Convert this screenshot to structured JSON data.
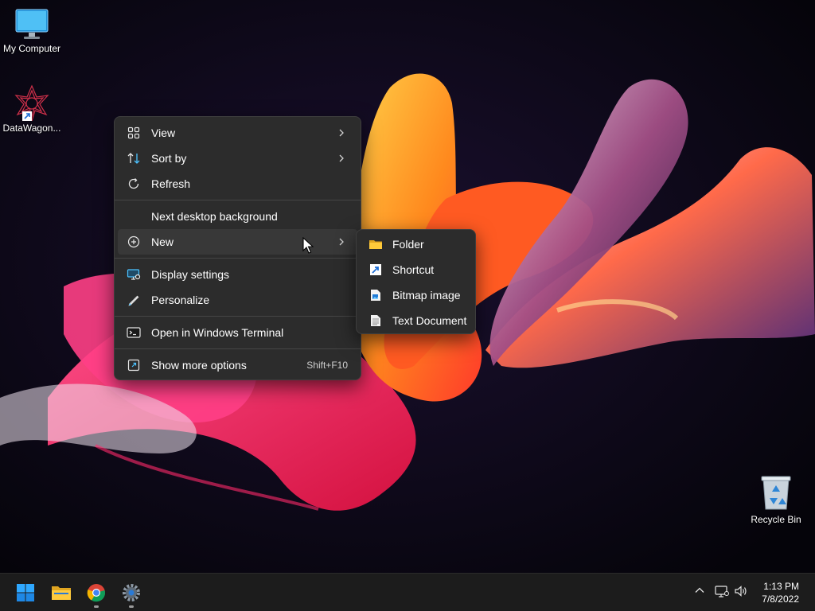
{
  "desktop": {
    "icons": [
      {
        "label": "My Computer",
        "icon": "monitor-icon"
      },
      {
        "label": "DataWagon...",
        "icon": "datawagon-app-icon"
      },
      {
        "label": "Recycle Bin",
        "icon": "recycle-bin-icon"
      }
    ]
  },
  "context_menu": {
    "items": [
      {
        "label": "View",
        "icon": "grid-icon",
        "has_submenu": true
      },
      {
        "label": "Sort by",
        "icon": "sort-icon",
        "has_submenu": true
      },
      {
        "label": "Refresh",
        "icon": "refresh-icon"
      },
      {
        "label": "Next desktop background"
      },
      {
        "label": "New",
        "icon": "plus-circle-icon",
        "has_submenu": true,
        "highlighted": true
      },
      {
        "label": "Display settings",
        "icon": "display-icon"
      },
      {
        "label": "Personalize",
        "icon": "pen-icon"
      },
      {
        "label": "Open in Windows Terminal",
        "icon": "terminal-icon"
      },
      {
        "label": "Show more options",
        "icon": "share-icon",
        "shortcut": "Shift+F10"
      }
    ]
  },
  "new_submenu": {
    "items": [
      {
        "label": "Folder",
        "icon": "folder-icon"
      },
      {
        "label": "Shortcut",
        "icon": "shortcut-icon"
      },
      {
        "label": "Bitmap image",
        "icon": "bitmap-icon"
      },
      {
        "label": "Text Document",
        "icon": "text-document-icon"
      }
    ]
  },
  "taskbar": {
    "apps": [
      "start-icon",
      "file-explorer-icon",
      "chrome-icon",
      "settings-icon"
    ],
    "clock": {
      "time": "1:13 PM",
      "date": "7/8/2022"
    }
  },
  "colors": {
    "accent": "#4cc2ff",
    "menu_bg": "#2c2c2c",
    "taskbar_bg": "#1c1c1c"
  }
}
